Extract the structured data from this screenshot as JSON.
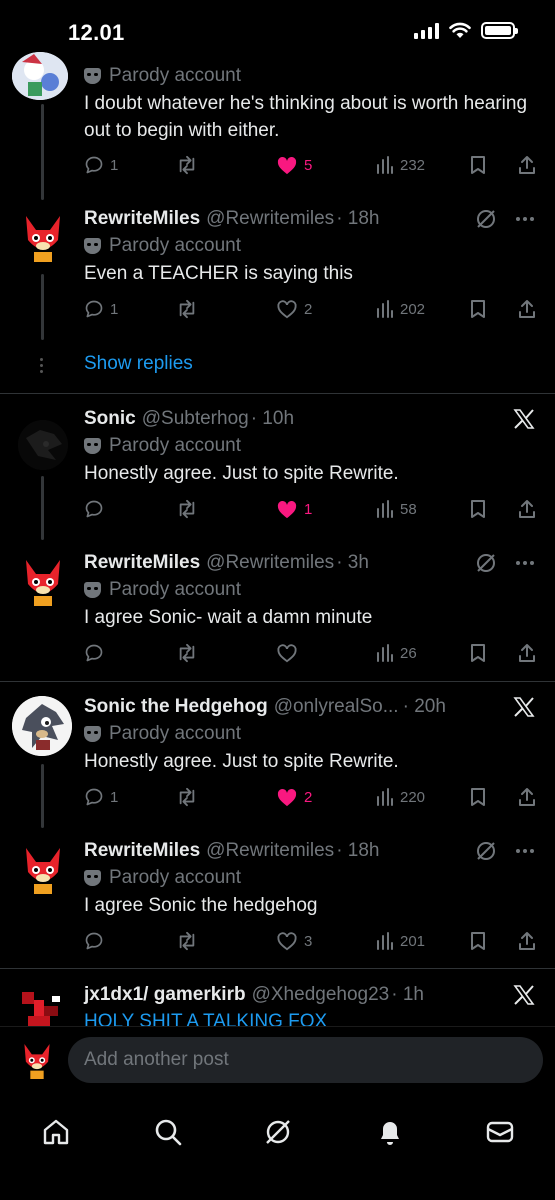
{
  "status": {
    "time": "12.01"
  },
  "posts": [
    {
      "parody_label": "Parody account",
      "text": "I doubt whatever he's thinking about is worth hearing out to begin with either.",
      "replies": "1",
      "likes": "5",
      "views": "232"
    },
    {
      "name": "RewriteMiles",
      "handle": "@Rewritemiles",
      "time": "· 18h",
      "parody_label": "Parody account",
      "text": "Even a TEACHER is saying this",
      "replies": "1",
      "likes": "2",
      "views": "202"
    },
    {
      "name": "Sonic",
      "handle": "@Subterhog",
      "time": "· 10h",
      "parody_label": "Parody account",
      "text": "Honestly agree. Just to spite Rewrite.",
      "replies": "",
      "likes": "1",
      "views": "58"
    },
    {
      "name": "RewriteMiles",
      "handle": "@Rewritemiles",
      "time": "· 3h",
      "parody_label": "Parody account",
      "text": "I agree Sonic- wait a damn minute",
      "replies": "",
      "likes": "",
      "views": "26"
    },
    {
      "name": "Sonic the Hedgehog",
      "handle": "@onlyrealSo...",
      "time": "· 20h",
      "parody_label": "Parody account",
      "text": "Honestly agree. Just to spite Rewrite.",
      "replies": "1",
      "likes": "2",
      "views": "220"
    },
    {
      "name": "RewriteMiles",
      "handle": "@Rewritemiles",
      "time": "· 18h",
      "parody_label": "Parody account",
      "text": "I agree Sonic the hedgehog",
      "replies": "",
      "likes": "3",
      "views": "201"
    },
    {
      "name": "jx1dx1/ gamerkirb",
      "handle": "@Xhedgehog23",
      "time": "· 1h",
      "text": "HOLY SHIT A TALKING FOX"
    }
  ],
  "show_replies": "Show replies",
  "compose": {
    "placeholder": "Add another post"
  },
  "colors": {
    "background": "#000000",
    "like": "#f91880",
    "link": "#1d9bf0",
    "muted": "#71767b"
  }
}
